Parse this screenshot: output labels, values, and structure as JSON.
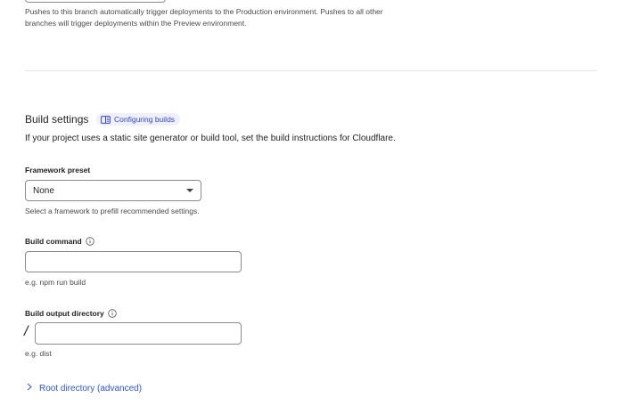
{
  "branch": {
    "help_line_1": "Pushes to this branch automatically trigger deployments to the Production environment. Pushes to all other",
    "help_line_2": "branches will trigger deployments within the Preview environment."
  },
  "build_settings": {
    "title": "Build settings",
    "docs_link_label": "Configuring builds",
    "description": "If your project uses a static site generator or build tool, set the build instructions for Cloudflare."
  },
  "framework_preset": {
    "label": "Framework preset",
    "selected": "None",
    "help": "Select a framework to prefill recommended settings."
  },
  "build_command": {
    "label": "Build command",
    "value": "",
    "help": "e.g. npm run build"
  },
  "build_output_directory": {
    "label": "Build output directory",
    "prefix": "/",
    "value": "",
    "help": "e.g. dist"
  },
  "root_directory": {
    "label": "Root directory (advanced)"
  },
  "colors": {
    "link": "#2f55c8",
    "pill_bg": "#eef0fb",
    "pill_text": "#3645c3",
    "border": "#8c8c8c"
  }
}
